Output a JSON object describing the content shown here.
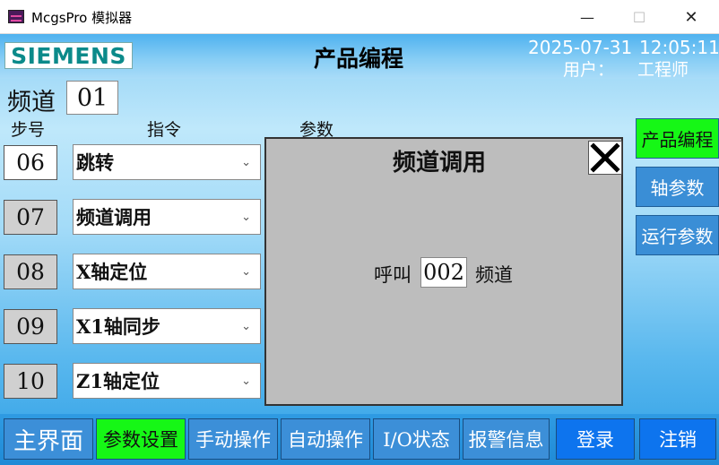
{
  "window": {
    "title": "McgsPro 模拟器",
    "min": "—",
    "max": "☐",
    "close": "✕"
  },
  "header": {
    "logo": "SIEMENS",
    "title": "产品编程",
    "date": "2025-07-31",
    "time": "12:05:11",
    "user_label": "用户：",
    "user_name": "工程师"
  },
  "channel": {
    "label": "频道",
    "value": "01"
  },
  "columns": {
    "step": "步号",
    "command": "指令",
    "param": "参数"
  },
  "steps": [
    {
      "step": "06",
      "command": "跳转",
      "active": true
    },
    {
      "step": "07",
      "command": "频道调用",
      "active": false
    },
    {
      "step": "08",
      "command": "X轴定位",
      "active": false
    },
    {
      "step": "09",
      "command": "X1轴同步",
      "active": false
    },
    {
      "step": "10",
      "command": "Z1轴定位",
      "active": false
    }
  ],
  "dialog": {
    "title": "频道调用",
    "call_label": "呼叫",
    "value": "002",
    "unit": "频道"
  },
  "right_nav": [
    {
      "label": "产品编程",
      "active": true
    },
    {
      "label": "轴参数",
      "active": false
    },
    {
      "label": "运行参数",
      "active": false
    }
  ],
  "bottom_nav": [
    {
      "label": "主界面"
    },
    {
      "label": "参数设置",
      "active": true
    },
    {
      "label": "手动操作"
    },
    {
      "label": "自动操作"
    },
    {
      "label": "I/O状态"
    },
    {
      "label": "报警信息"
    },
    {
      "label": "登录"
    },
    {
      "label": "注销"
    }
  ],
  "colors": {
    "accent_green": "#16f716",
    "nav_blue": "#3c8fd8",
    "login_blue": "#0d74ee"
  },
  "icons": {
    "app": "mcgs-app-icon",
    "dropdown": "chevron-down-icon",
    "close": "close-icon"
  }
}
